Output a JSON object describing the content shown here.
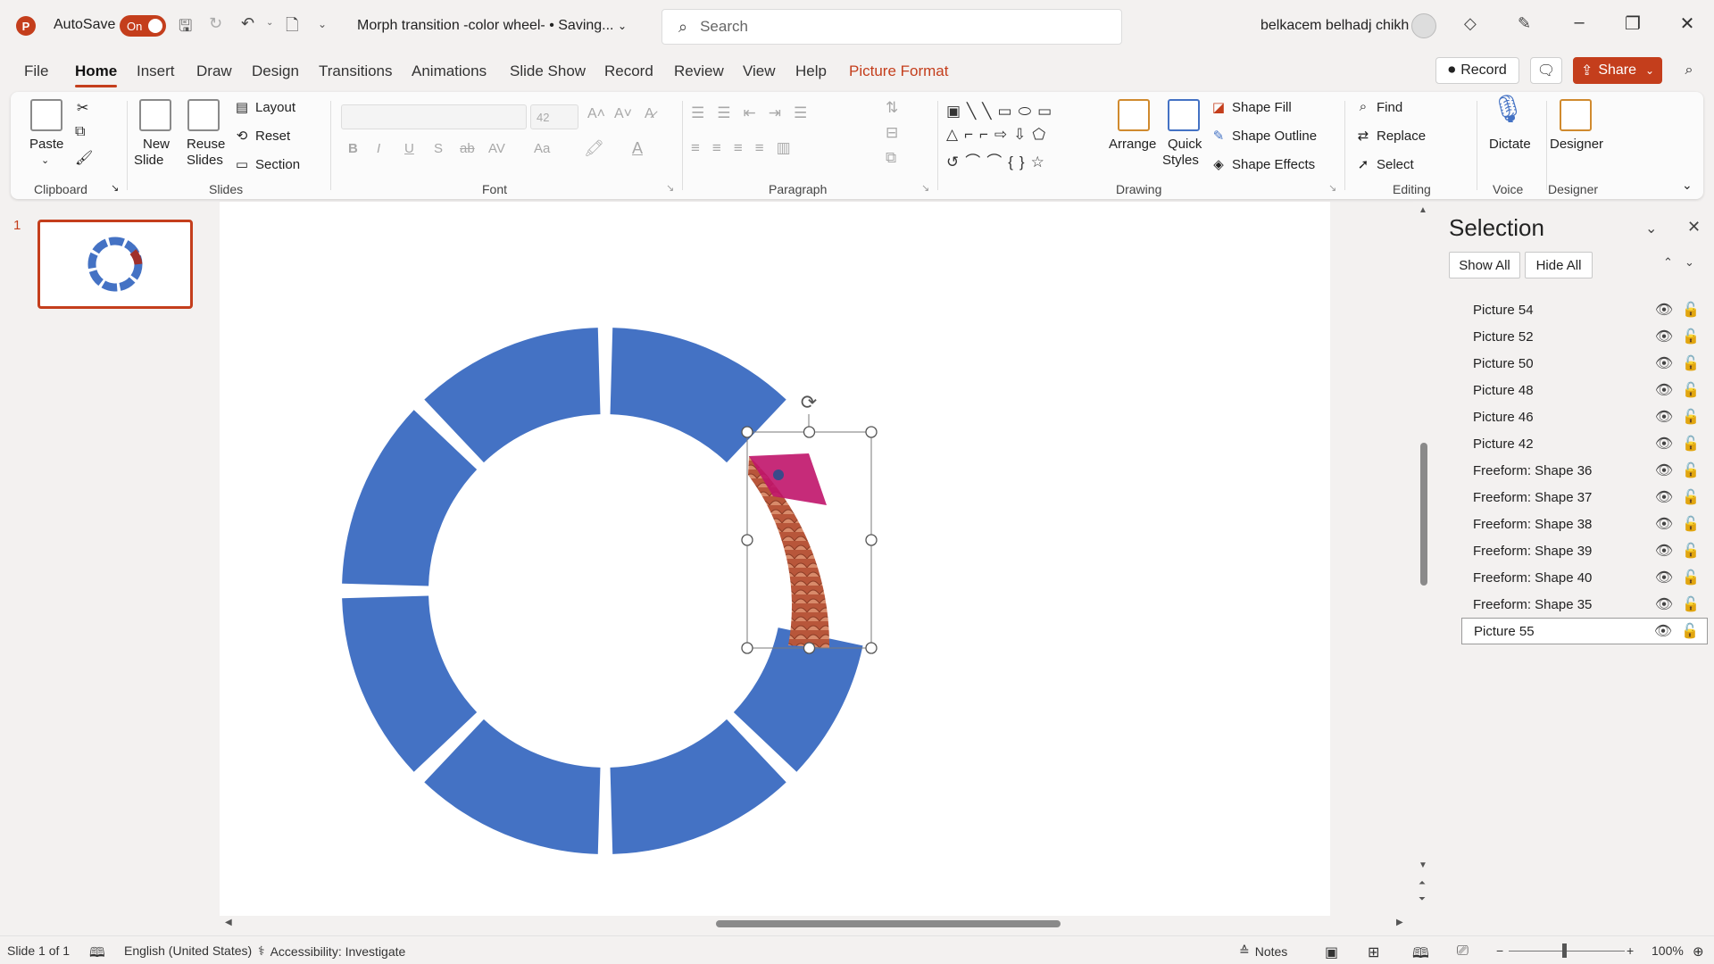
{
  "titlebar": {
    "app_logo": "P",
    "autosave_label": "AutoSave",
    "autosave_state": "On",
    "doc_title": "Morph transition -color wheel- • Saving...",
    "search_placeholder": "Search",
    "user_name": "belkacem belhadj chikh"
  },
  "tabs": [
    "File",
    "Home",
    "Insert",
    "Draw",
    "Design",
    "Transitions",
    "Animations",
    "Slide Show",
    "Record",
    "Review",
    "View",
    "Help",
    "Picture Format"
  ],
  "tab_right": {
    "record": "Record",
    "share": "Share"
  },
  "ribbon": {
    "clipboard": {
      "paste": "Paste",
      "label": "Clipboard"
    },
    "slides": {
      "new_slide_1": "New",
      "new_slide_2": "Slide",
      "reuse_1": "Reuse",
      "reuse_2": "Slides",
      "layout": "Layout",
      "reset": "Reset",
      "section": "Section",
      "label": "Slides"
    },
    "font": {
      "size": "42",
      "label": "Font",
      "bold": "B",
      "italic": "I",
      "underline": "U",
      "shadow": "S",
      "strike": "ab",
      "spacing": "AV",
      "case": "Aa"
    },
    "paragraph": {
      "label": "Paragraph"
    },
    "drawing": {
      "arrange": "Arrange",
      "quick_1": "Quick",
      "quick_2": "Styles",
      "fill": "Shape Fill",
      "outline": "Shape Outline",
      "effects": "Shape Effects",
      "label": "Drawing"
    },
    "editing": {
      "find": "Find",
      "replace": "Replace",
      "select": "Select",
      "label": "Editing"
    },
    "voice": {
      "dictate": "Dictate",
      "label": "Voice"
    },
    "designer": {
      "designer": "Designer",
      "label": "Designer"
    }
  },
  "thumbs": {
    "slide_number": "1"
  },
  "selection_pane": {
    "title": "Selection",
    "show_all": "Show All",
    "hide_all": "Hide All",
    "items": [
      {
        "label": "Picture 54"
      },
      {
        "label": "Picture 52"
      },
      {
        "label": "Picture 50"
      },
      {
        "label": "Picture 48"
      },
      {
        "label": "Picture 46"
      },
      {
        "label": "Picture 42"
      },
      {
        "label": "Freeform: Shape 36"
      },
      {
        "label": "Freeform: Shape 37"
      },
      {
        "label": "Freeform: Shape 38"
      },
      {
        "label": "Freeform: Shape 39"
      },
      {
        "label": "Freeform: Shape 40"
      },
      {
        "label": "Freeform: Shape 35"
      },
      {
        "label": "Picture 55"
      }
    ],
    "selected_index": 12
  },
  "statusbar": {
    "slide_info": "Slide 1 of 1",
    "language": "English (United States)",
    "accessibility": "Accessibility: Investigate",
    "notes": "Notes",
    "zoom": "100%"
  },
  "colors": {
    "accent": "#c43e1c",
    "segment": "#4472c4"
  },
  "icons": [
    "search-icon",
    "undo-icon",
    "redo-icon",
    "save-icon",
    "eye-icon",
    "lock-icon",
    "rotate-handle-icon",
    "minimize-icon",
    "maximize-icon",
    "close-icon"
  ]
}
